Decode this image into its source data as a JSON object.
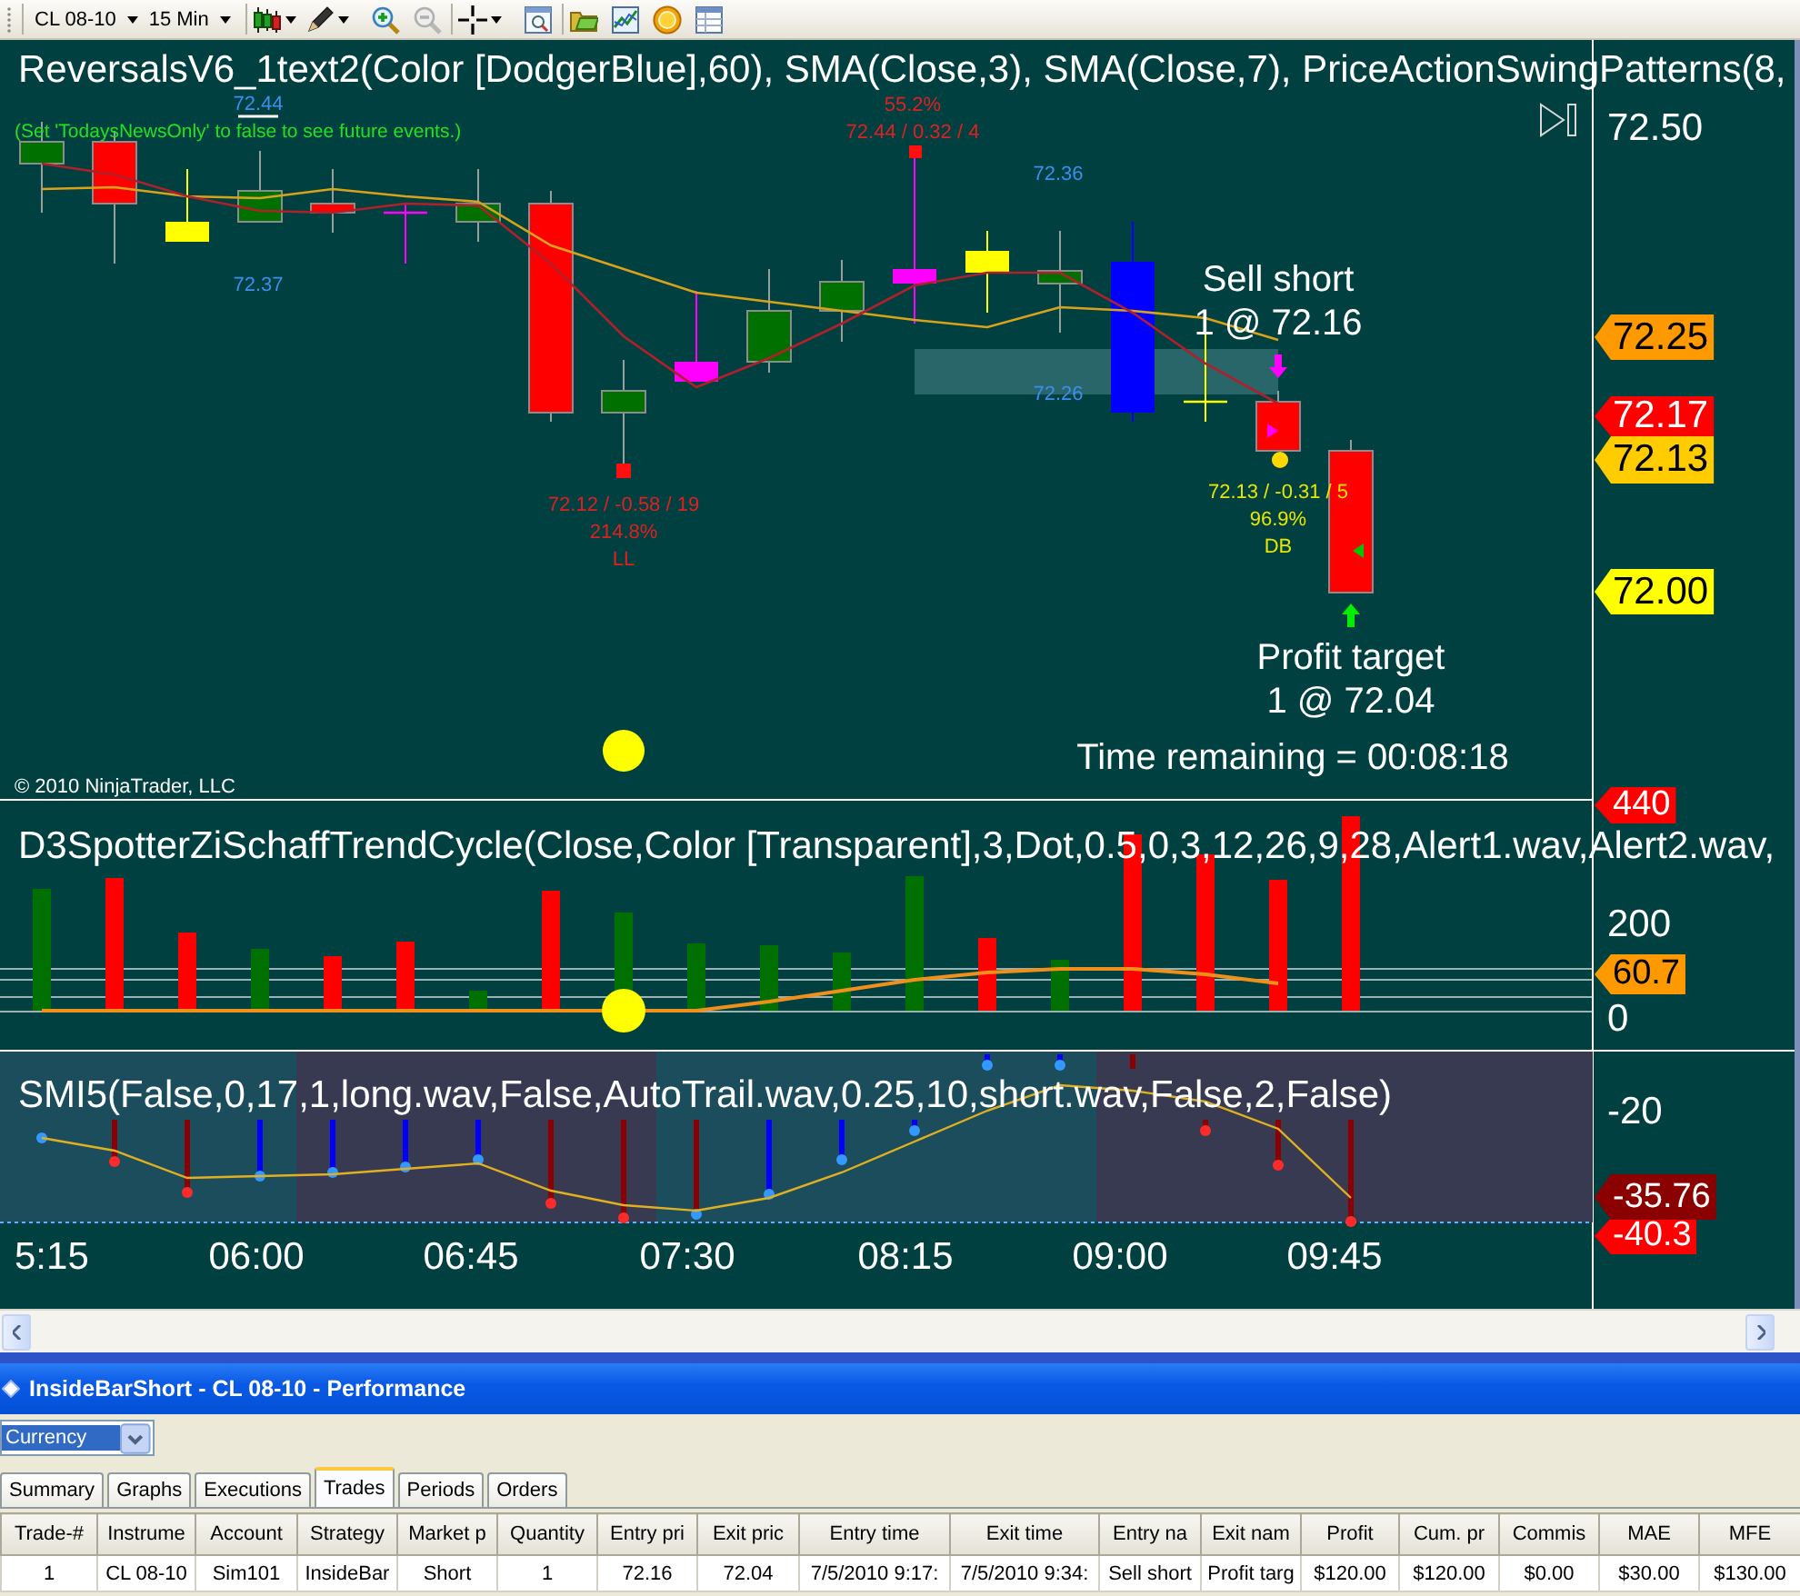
{
  "toolbar": {
    "instrument": "CL 08-10",
    "interval": "15 Min"
  },
  "price_panel": {
    "title": "ReversalsV6_1text2(Color [DodgerBlue],60), SMA(Close,3), SMA(Close,7), PriceActionSwingPatterns(8,",
    "news_note": "(Set 'TodaysNewsOnly' to false to see future events.)",
    "level_labels": [
      "72.44",
      "72.37",
      "72.36",
      "72.26"
    ],
    "swing_labels": [
      {
        "color": "#e02020",
        "lines": [
          "55.2%",
          "72.44 / 0.32 / 4"
        ]
      },
      {
        "color": "#e02020",
        "lines": [
          "72.12 / -0.58 / 19",
          "214.8%",
          "LL"
        ]
      },
      {
        "color": "#e6e600",
        "lines": [
          "72.13 / -0.31 / 5",
          "96.9%",
          "DB"
        ]
      }
    ],
    "orders": [
      {
        "kind": "entry",
        "action": "Sell short",
        "fill": "1 @ 72.16"
      },
      {
        "kind": "exit",
        "action": "Profit target",
        "fill": "1 @ 72.04"
      }
    ],
    "timer": "Time remaining = 00:08:18",
    "copyright": "© 2010 NinjaTrader, LLC",
    "axis_ticks": [
      "72.50"
    ],
    "price_tags": [
      {
        "text": "72.25",
        "color": "#ff9900"
      },
      {
        "text": "72.17",
        "color": "#ff0000"
      },
      {
        "text": "72.13",
        "color": "#ffcc00"
      },
      {
        "text": "72.00",
        "color": "#ffff00"
      }
    ]
  },
  "oscillator_panel": {
    "title": "D3SpotterZiSchaffTrendCycle(Close,Color [Transparent],3,Dot,0.5,0,3,12,26,9,28,Alert1.wav,Alert2.wav,",
    "axis_ticks": [
      "200",
      "0"
    ],
    "value_tags": [
      {
        "text": "440",
        "color": "#ff0000"
      },
      {
        "text": "60.7",
        "color": "#ff9900"
      }
    ]
  },
  "smi_panel": {
    "title": "SMI5(False,0,17,1,long.wav,False,AutoTrail.wav,0.25,10,short.wav,False,2,False)",
    "axis_ticks": [
      "-20"
    ],
    "value_tags": [
      {
        "text": "-35.76",
        "color": "#8b0000"
      },
      {
        "text": "-40.3",
        "color": "#ff0000"
      }
    ]
  },
  "time_axis": [
    "5:15",
    "06:00",
    "06:45",
    "07:30",
    "08:15",
    "09:00",
    "09:45"
  ],
  "performance": {
    "title": "InsideBarShort - CL 08-10 - Performance",
    "display_unit": "Currency",
    "tabs": [
      {
        "label": "Summary",
        "selected": false
      },
      {
        "label": "Graphs",
        "selected": false
      },
      {
        "label": "Executions",
        "selected": false
      },
      {
        "label": "Trades",
        "selected": true
      },
      {
        "label": "Periods",
        "selected": false
      },
      {
        "label": "Orders",
        "selected": false
      }
    ],
    "columns": [
      "Trade-#",
      "Instrume",
      "Account",
      "Strategy",
      "Market p",
      "Quantity",
      "Entry pri",
      "Exit pric",
      "Entry time",
      "Exit time",
      "Entry na",
      "Exit nam",
      "Profit",
      "Cum. pr",
      "Commis",
      "MAE",
      "MFE"
    ],
    "rows": [
      [
        "1",
        "CL 08-10",
        "Sim101",
        "InsideBar",
        "Short",
        "1",
        "72.16",
        "72.04",
        "7/5/2010 9:17:",
        "7/5/2010 9:34:",
        "Sell short",
        "Profit targ",
        "$120.00",
        "$120.00",
        "$0.00",
        "$30.00",
        "$130.00"
      ]
    ]
  }
}
